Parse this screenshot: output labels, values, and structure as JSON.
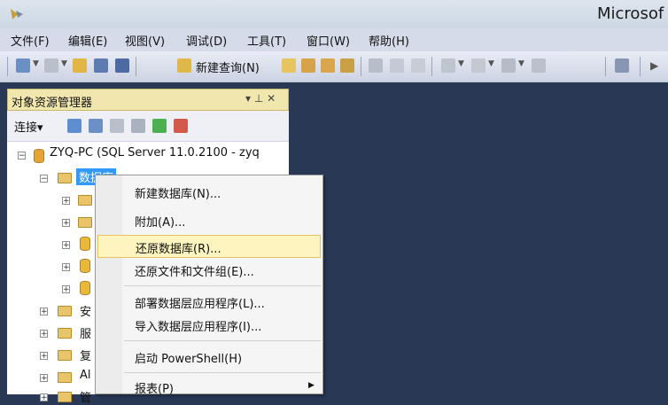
{
  "window": {
    "title": "Microsof",
    "icon": "ssms-app-icon"
  },
  "menubar": {
    "items": [
      "文件(F)",
      "编辑(E)",
      "视图(V)",
      "调试(D)",
      "工具(T)",
      "窗口(W)",
      "帮助(H)"
    ]
  },
  "toolbar": {
    "new_query_label": "新建查询(N)"
  },
  "object_explorer": {
    "title": "对象资源管理器",
    "pin_glyph": "▾ ⊥ ✕",
    "connect_label": "连接▾",
    "tree": {
      "server": "ZYQ-PC (SQL Server 11.0.2100 - zyq",
      "databases_label": "数据库",
      "truncated_nodes": [
        "安",
        "服",
        "复",
        "Al",
        "管"
      ]
    }
  },
  "context_menu": {
    "items": [
      {
        "label": "新建数据库(N)..."
      },
      {
        "label": "附加(A)..."
      },
      {
        "label": "还原数据库(R)...",
        "highlighted": true
      },
      {
        "label": "还原文件和文件组(E)..."
      },
      {
        "label": "部署数据层应用程序(L)..."
      },
      {
        "label": "导入数据层应用程序(I)..."
      },
      {
        "label": "启动 PowerShell(H)"
      },
      {
        "label": "报表(P)",
        "has_submenu": true
      }
    ]
  },
  "colors": {
    "background": "#293955",
    "panel_header": "#f1e7ae",
    "highlight": "#fdf4bf"
  }
}
